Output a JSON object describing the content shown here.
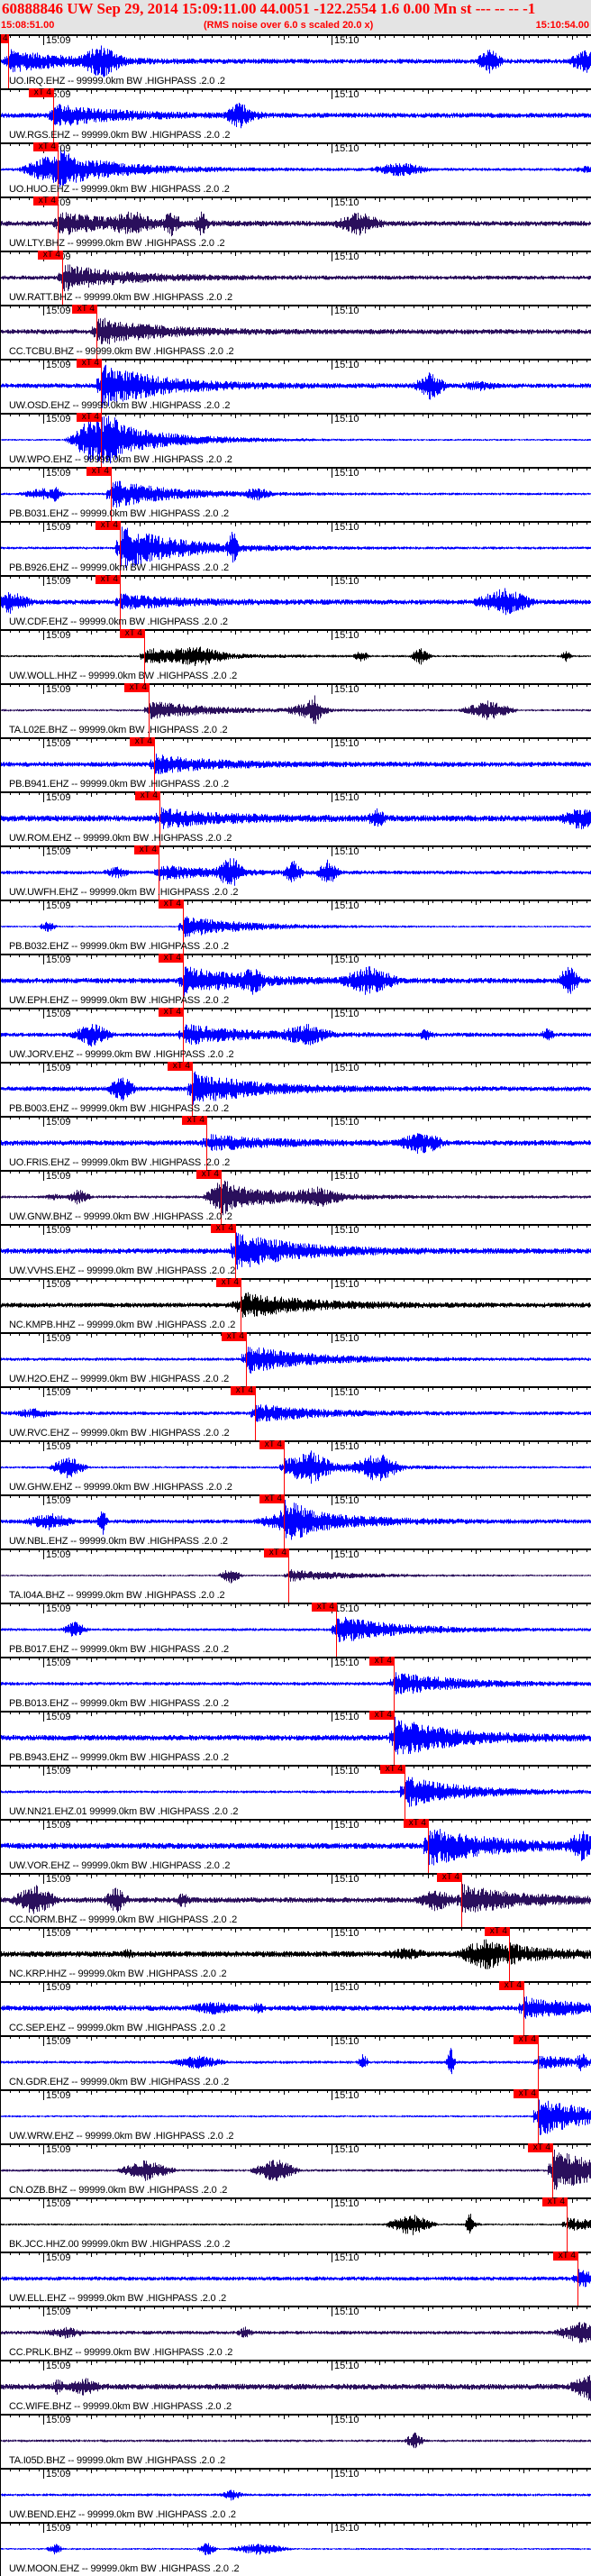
{
  "header": {
    "title": "60888846 UW Sep 29, 2014 15:09:11.00    44.0051 -122.2554  1.6 0.00 Mn st --- -- --  -1",
    "start_time": "15:08:51.00",
    "note": "(RMS noise over 6.0 s scaled 20.0 x)",
    "end_time": "15:10:54.00"
  },
  "axis": {
    "duration_s": 123,
    "tick_labels": [
      {
        "label": "15:09",
        "t": 9
      },
      {
        "label": "15:10",
        "t": 69
      }
    ]
  },
  "colors": {
    "blue": "#0000ff",
    "purple": "#2a0f5c",
    "black": "#000000",
    "pick": "#ff0000"
  },
  "traces": [
    {
      "label": "UO.IRQ.EHZ -- 99999.0km BW .HIGHPASS .2.0 .2",
      "color": "blue",
      "pick": "4",
      "pick_t": 1.7
    },
    {
      "label": "UW.RGS.EHZ -- 99999.0km BW .HIGHPASS .2.0 .2",
      "color": "blue",
      "pick": "xT 4",
      "pick_t": 11.1
    },
    {
      "label": "UO.HUO.EHZ -- 99999.0km BW .HIGHPASS .2.0 .2",
      "color": "blue",
      "pick": "xT 4",
      "pick_t": 12.0
    },
    {
      "label": "UW.LTY.BHZ -- 99999.0km BW .HIGHPASS .2.0 .2",
      "color": "purple",
      "pick": "xT 4",
      "pick_t": 12.0
    },
    {
      "label": "UW.RATT.BHZ -- 99999.0km BW .HIGHPASS .2.0 .2",
      "color": "purple",
      "pick": "xT 4",
      "pick_t": 12.9
    },
    {
      "label": "CC.TCBU.BHZ -- 99999.0km BW .HIGHPASS .2.0 .2",
      "color": "purple",
      "pick": "xT 4",
      "pick_t": 20.1
    },
    {
      "label": "UW.OSD.EHZ -- 99999.0km BW .HIGHPASS .2.0 .2",
      "color": "blue",
      "pick": "xT 4",
      "pick_t": 21.0
    },
    {
      "label": "UW.WPO.EHZ -- 99999.0km BW .HIGHPASS .2.0 .2",
      "color": "blue",
      "pick": "xT 4",
      "pick_t": 21.0
    },
    {
      "label": "PB.B031.EHZ -- 99999.0km BW .HIGHPASS .2.0 .2",
      "color": "blue",
      "pick": "xT 4",
      "pick_t": 23.1
    },
    {
      "label": "PB.B926.EHZ -- 99999.0km BW .HIGHPASS .2.0 .2",
      "color": "blue",
      "pick": "xT 4",
      "pick_t": 24.9
    },
    {
      "label": "UW.CDF.EHZ -- 99999.0km BW .HIGHPASS .2.0 .2",
      "color": "blue",
      "pick": "xT 4",
      "pick_t": 24.9
    },
    {
      "label": "UW.WOLL.HHZ -- 99999.0km BW .HIGHPASS .2.0 .2",
      "color": "black",
      "pick": "xT 4",
      "pick_t": 30.0
    },
    {
      "label": "TA.L02E.BHZ -- 99999.0km BW .HIGHPASS .2.0 .2",
      "color": "purple",
      "pick": "xT 4",
      "pick_t": 30.9
    },
    {
      "label": "PB.B941.EHZ -- 99999.0km BW .HIGHPASS .2.0 .2",
      "color": "blue",
      "pick": "xT 4",
      "pick_t": 32.1
    },
    {
      "label": "UW.ROM.EHZ -- 99999.0km BW .HIGHPASS .2.0 .2",
      "color": "blue",
      "pick": "xT 4",
      "pick_t": 33.2
    },
    {
      "label": "UW.UWFH.EHZ -- 99999.0km BW .HIGHPASS .2.0 .2",
      "color": "blue",
      "pick": "xT 4",
      "pick_t": 33.0
    },
    {
      "label": "PB.B032.EHZ -- 99999.0km BW .HIGHPASS .2.0 .2",
      "color": "blue",
      "pick": "xT 4",
      "pick_t": 38.1
    },
    {
      "label": "UW.EPH.EHZ -- 99999.0km BW .HIGHPASS .2.0 .2",
      "color": "blue",
      "pick": "xT 4",
      "pick_t": 38.1
    },
    {
      "label": "UW.JORV.EHZ -- 99999.0km BW .HIGHPASS .2.0 .2",
      "color": "blue",
      "pick": "xT 4",
      "pick_t": 38.1
    },
    {
      "label": "PB.B003.EHZ -- 99999.0km BW .HIGHPASS .2.0 .2",
      "color": "blue",
      "pick": "xT 4",
      "pick_t": 39.9
    },
    {
      "label": "UO.FRIS.EHZ -- 99999.0km BW .HIGHPASS .2.0 .2",
      "color": "blue",
      "pick": "xT 4",
      "pick_t": 42.9
    },
    {
      "label": "UW.GNW.BHZ -- 99999.0km BW .HIGHPASS .2.0 .2",
      "color": "purple",
      "pick": "xT 4",
      "pick_t": 45.9
    },
    {
      "label": "UW.VVHS.EHZ -- 99999.0km BW .HIGHPASS .2.0 .2",
      "color": "blue",
      "pick": "xT 4",
      "pick_t": 48.9
    },
    {
      "label": "NC.KMPB.HHZ -- 99999.0km BW .HIGHPASS .2.0 .2",
      "color": "black",
      "pick": "xT 4",
      "pick_t": 50.1
    },
    {
      "label": "UW.H2O.EHZ -- 99999.0km BW .HIGHPASS .2.0 .2",
      "color": "blue",
      "pick": "xT 4",
      "pick_t": 51.2
    },
    {
      "label": "UW.RVC.EHZ -- 99999.0km BW .HIGHPASS .2.0 .2",
      "color": "blue",
      "pick": "xT 4",
      "pick_t": 53.1
    },
    {
      "label": "UW.GHW.EHZ -- 99999.0km BW .HIGHPASS .2.0 .2",
      "color": "blue",
      "pick": "xT 4",
      "pick_t": 59.1
    },
    {
      "label": "UW.NBL.EHZ -- 99999.0km BW .HIGHPASS .2.0 .2",
      "color": "blue",
      "pick": "xT 4",
      "pick_t": 59.1
    },
    {
      "label": "TA.I04A.BHZ -- 99999.0km BW .HIGHPASS .2.0 .2",
      "color": "purple",
      "pick": "xT 4",
      "pick_t": 60.0
    },
    {
      "label": "PB.B017.EHZ -- 99999.0km BW .HIGHPASS .2.0 .2",
      "color": "blue",
      "pick": "xT 4",
      "pick_t": 70.0
    },
    {
      "label": "PB.B013.EHZ -- 99999.0km BW .HIGHPASS .2.0 .2",
      "color": "blue",
      "pick": "xT 4",
      "pick_t": 81.9
    },
    {
      "label": "PB.B943.EHZ -- 99999.0km BW .HIGHPASS .2.0 .2",
      "color": "blue",
      "pick": "xT 4",
      "pick_t": 81.9
    },
    {
      "label": "UW.NN21.EHZ.01 99999.0km BW .HIGHPASS .2.0 .2",
      "color": "blue",
      "pick": "xT 4",
      "pick_t": 84.2
    },
    {
      "label": "UW.VOR.EHZ -- 99999.0km BW .HIGHPASS .2.0 .2",
      "color": "blue",
      "pick": "xT 4",
      "pick_t": 89.1
    },
    {
      "label": "CC.NORM.BHZ -- 99999.0km BW .HIGHPASS .2.0 .2",
      "color": "purple",
      "pick": "xT 4",
      "pick_t": 96.0
    },
    {
      "label": "NC.KRP.HHZ -- 99999.0km BW .HIGHPASS .2.0 .2",
      "color": "black",
      "pick": "xT 4",
      "pick_t": 105.9
    },
    {
      "label": "CC.SEP.EHZ -- 99999.0km BW .HIGHPASS .2.0 .2",
      "color": "blue",
      "pick": "xT 4",
      "pick_t": 108.9
    },
    {
      "label": "CN.GDR.EHZ -- 99999.0km BW .HIGHPASS .2.0 .2",
      "color": "blue",
      "pick": "xT 4",
      "pick_t": 111.9
    },
    {
      "label": "UW.WRW.EHZ -- 99999.0km BW .HIGHPASS .2.0 .2",
      "color": "blue",
      "pick": "xT 4",
      "pick_t": 111.9
    },
    {
      "label": "CN.OZB.BHZ -- 99999.0km BW .HIGHPASS .2.0 .2",
      "color": "purple",
      "pick": "xT 4",
      "pick_t": 114.9
    },
    {
      "label": "BK.JCC.HHZ.00 99999.0km BW .HIGHPASS .2.0 .2",
      "color": "black",
      "pick": "xT 4",
      "pick_t": 117.9
    },
    {
      "label": "UW.ELL.EHZ -- 99999.0km BW .HIGHPASS .2.0 .2",
      "color": "blue",
      "pick": "xT 4",
      "pick_t": 120.2
    },
    {
      "label": "CC.PRLK.BHZ -- 99999.0km BW .HIGHPASS .2.0 .2",
      "color": "purple",
      "pick": null,
      "pick_t": null
    },
    {
      "label": "CC.WIFE.BHZ -- 99999.0km BW .HIGHPASS .2.0 .2",
      "color": "purple",
      "pick": null,
      "pick_t": null
    },
    {
      "label": "TA.I05D.BHZ -- 99999.0km BW .HIGHPASS .2.0 .2",
      "color": "purple",
      "pick": null,
      "pick_t": null
    },
    {
      "label": "UW.BEND.EHZ -- 99999.0km BW .HIGHPASS .2.0 .2",
      "color": "blue",
      "pick": null,
      "pick_t": null
    },
    {
      "label": "UW.MOON.EHZ -- 99999.0km BW .HIGHPASS .2.0 .2",
      "color": "blue",
      "pick": null,
      "pick_t": null
    }
  ]
}
